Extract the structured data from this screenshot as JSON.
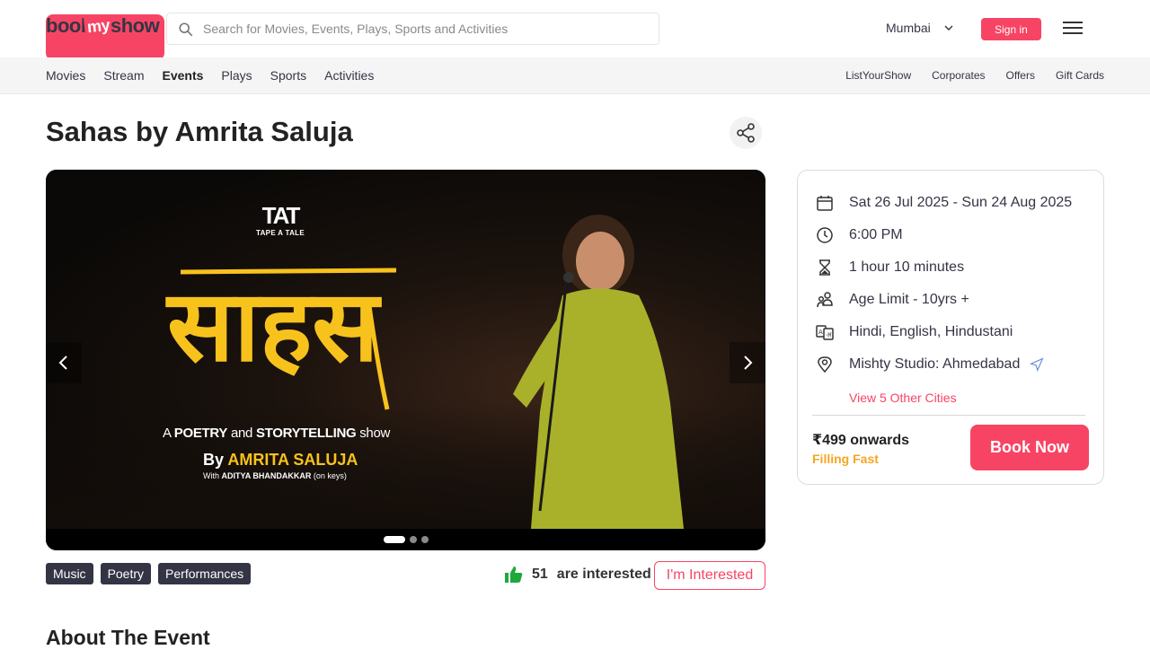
{
  "header": {
    "logo": {
      "book": "book",
      "my": "my",
      "show": "show"
    },
    "search_placeholder": "Search for Movies, Events, Plays, Sports and Activities",
    "city": "Mumbai",
    "signin_label": "Sign in"
  },
  "subnav": {
    "left": [
      "Movies",
      "Stream",
      "Events",
      "Plays",
      "Sports",
      "Activities"
    ],
    "active": "Events",
    "right": [
      "ListYourShow",
      "Corporates",
      "Offers",
      "Gift Cards"
    ]
  },
  "event": {
    "title": "Sahas by Amrita Saluja",
    "banner": {
      "brand_mark": "TAT",
      "brand_text": "TAPE A TALE",
      "hindi_title": "साहस",
      "tagline_a": "A ",
      "tagline_b": "POETRY",
      "tagline_c": " and ",
      "tagline_d": "STORYTELLING",
      "tagline_e": " show",
      "by": "By ",
      "performer": "AMRITA SALUJA",
      "with_a": "With ",
      "with_b": "ADITYA BHANDAKKAR",
      "with_c": " (on keys)",
      "slides": 3,
      "active_slide": 1
    },
    "tags": [
      "Music",
      "Poetry",
      "Performances"
    ],
    "interested_count": "51",
    "interested_text": "are interested",
    "interested_button": "I'm Interested",
    "about_heading": "About The Event"
  },
  "info": {
    "date": "Sat 26 Jul 2025 - Sun 24 Aug 2025",
    "time": "6:00 PM",
    "duration": "1 hour 10 minutes",
    "age": "Age Limit - 10yrs +",
    "languages": "Hindi, English, Hindustani",
    "venue": "Mishty Studio: Ahmedabad",
    "other_cities": "View 5 Other Cities",
    "price": "₹499 onwards",
    "status": "Filling Fast",
    "book_label": "Book Now"
  },
  "colors": {
    "brand": "#f84464",
    "dark": "#333545",
    "warning": "#f5a623",
    "banner_yellow": "#f8c21c"
  }
}
